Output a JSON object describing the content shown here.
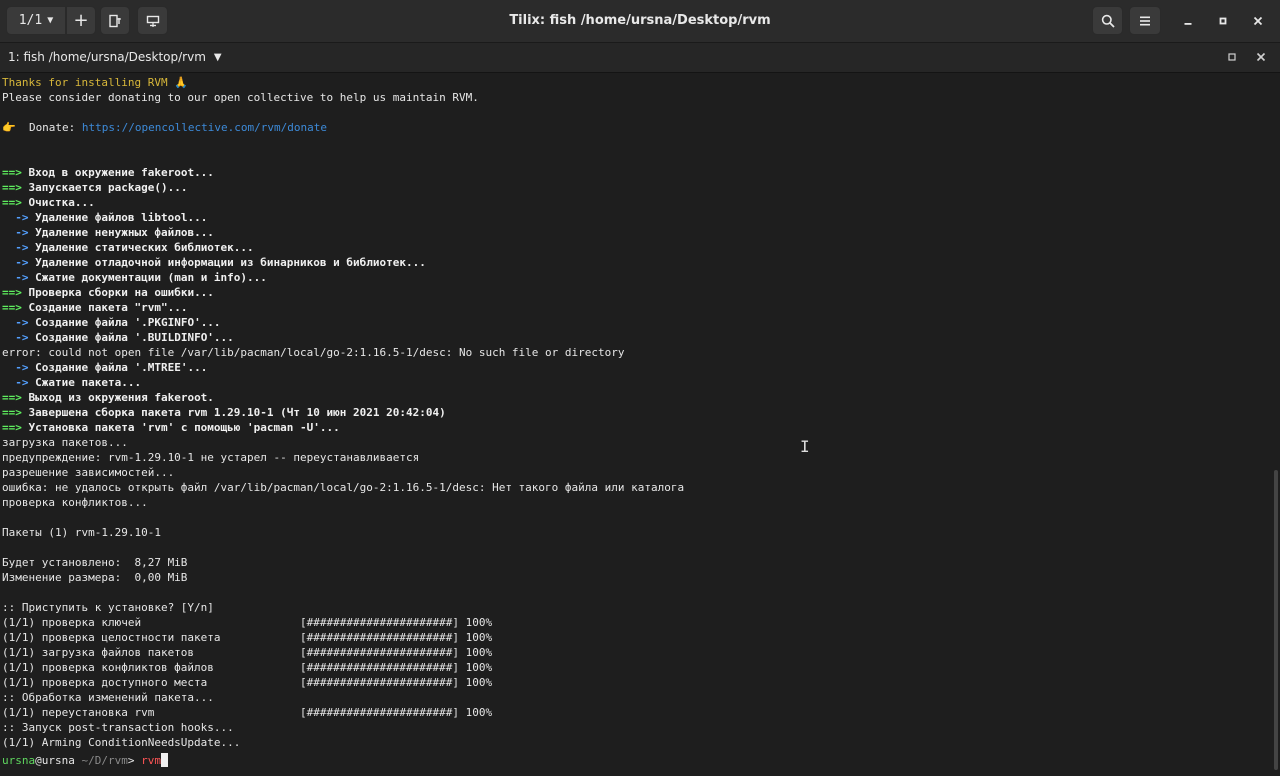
{
  "titlebar": {
    "session_label": "1/1",
    "title": "Tilix: fish /home/ursna/Desktop/rvm"
  },
  "tab": {
    "title": "1: fish /home/ursna/Desktop/rvm"
  },
  "icons": {
    "session_caret": "chevron-down-icon",
    "add": "plus-icon",
    "split_horizontal": "split-horizontal-icon",
    "split_vertical": "split-vertical-icon",
    "search": "search-icon",
    "menu": "hamburger-menu-icon",
    "minimize": "minimize-icon",
    "maximize": "maximize-icon",
    "close": "close-icon"
  },
  "terminal": {
    "line01": "Thanks for installing RVM 🙏",
    "line02": "Please consider donating to our open collective to help us maintain RVM.",
    "line04_prefix": "👉  Donate: ",
    "line04_link": "https://opencollective.com/rvm/donate",
    "l07": "Вход в окружение fakeroot...",
    "l08": "Запускается package()...",
    "l09": "Очистка...",
    "l10": "Удаление файлов libtool...",
    "l11": "Удаление ненужных файлов...",
    "l12": "Удаление статических библиотек...",
    "l13": "Удаление отладочной информации из бинарников и библиотек...",
    "l14": "Сжатие документации (man и info)...",
    "l15": "Проверка сборки на ошибки...",
    "l16": "Создание пакета \"rvm\"...",
    "l17": "Создание файла '.PKGINFO'...",
    "l18": "Создание файла '.BUILDINFO'...",
    "l19": "error: could not open file /var/lib/pacman/local/go-2:1.16.5-1/desc: No such file or directory",
    "l20": "Создание файла '.MTREE'...",
    "l21": "Сжатие пакета...",
    "l22": "Выход из окружения fakeroot.",
    "l23": "Завершена сборка пакета rvm 1.29.10-1 (Чт 10 июн 2021 20:42:04)",
    "l24": "Установка пакета 'rvm' с помощью 'pacman -U'...",
    "l25": "загрузка пакетов...",
    "l26": "предупреждение: rvm-1.29.10-1 не устарел -- переустанавливается",
    "l27": "разрешение зависимостей...",
    "l28": "ошибка: не удалось открыть файл /var/lib/pacman/local/go-2:1.16.5-1/desc: Нет такого файла или каталога",
    "l29": "проверка конфликтов...",
    "l31": "Пакеты (1) rvm-1.29.10-1",
    "l33": "Будет установлено:  8,27 MiB",
    "l34": "Изменение размера:  0,00 MiB",
    "l36": ":: Приступить к установке? [Y/n]",
    "l37": "(1/1) проверка ключей                        [######################] 100%",
    "l38": "(1/1) проверка целостности пакета            [######################] 100%",
    "l39": "(1/1) загрузка файлов пакетов                [######################] 100%",
    "l40": "(1/1) проверка конфликтов файлов             [######################] 100%",
    "l41": "(1/1) проверка доступного места              [######################] 100%",
    "l42": ":: Обработка изменений пакета...",
    "l43": "(1/1) переустановка rvm                      [######################] 100%",
    "l44": ":: Запуск post-transaction hooks...",
    "l45": "(1/1) Arming ConditionNeedsUpdate...",
    "prompt_user": "ursna",
    "prompt_at": "@",
    "prompt_host": "ursna",
    "prompt_path": " ~/D/rvm",
    "prompt_sym": "> ",
    "prompt_cmd": "rvm",
    "arrow_main": "==> ",
    "arrow_sub": "  -> "
  }
}
